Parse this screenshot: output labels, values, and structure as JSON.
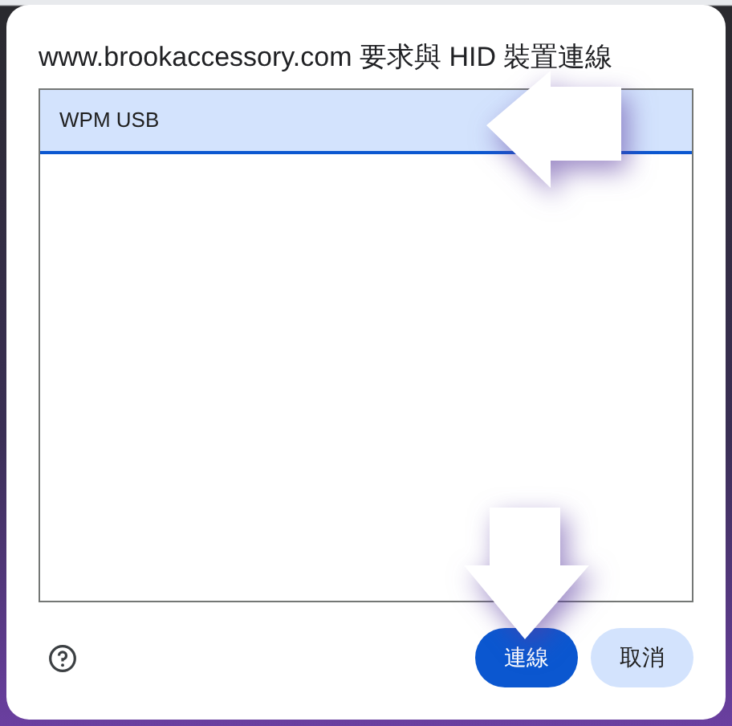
{
  "dialog": {
    "title": "www.brookaccessory.com 要求與 HID 裝置連線",
    "devices": [
      {
        "name": "WPM USB",
        "selected": true
      }
    ],
    "buttons": [
      {
        "label": "連線",
        "kind": "primary"
      },
      {
        "label": "取消",
        "kind": "secondary"
      }
    ]
  }
}
